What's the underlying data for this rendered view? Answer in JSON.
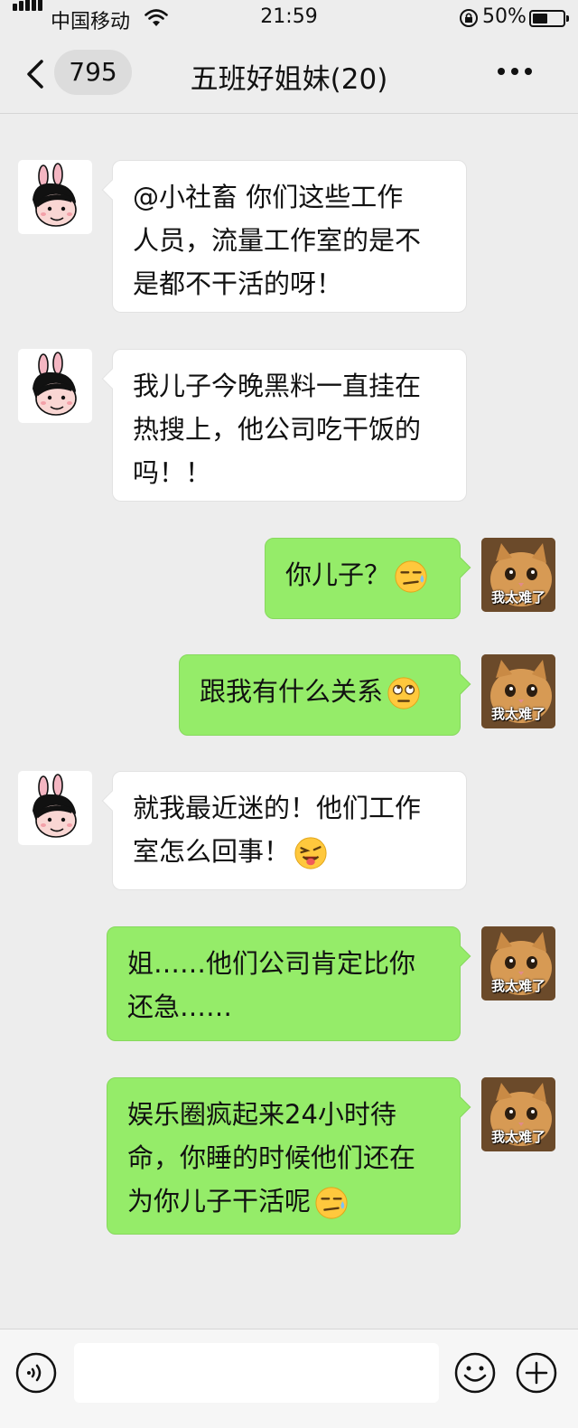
{
  "status_bar": {
    "carrier": "中国移动",
    "time": "21:59",
    "battery_percent": "50%",
    "battery_level": 0.5
  },
  "nav": {
    "unread_count": "795",
    "chat_title": "五班好姐妹(20)"
  },
  "messages": [
    {
      "side": "left",
      "text": "@小社畜 你们这些工作\n人员，流量工作室的是不\n是都不干活的呀！"
    },
    {
      "side": "left",
      "text": "我儿子今晚黑料一直挂在\n热搜上，他公司吃干饭的\n吗！！"
    },
    {
      "side": "right",
      "text": "你儿子？",
      "emoji": "smirk-sweat-emoji",
      "sticker_caption": "我太难了"
    },
    {
      "side": "right",
      "text": "跟我有什么关系",
      "emoji": "eye-roll-emoji",
      "sticker_caption": "我太难了"
    },
    {
      "side": "left",
      "text": "就我最近迷的！他们工作\n室怎么回事！",
      "emoji": "tongue-wink-emoji"
    },
    {
      "side": "right",
      "text": "姐……他们公司肯定比你\n还急……",
      "sticker_caption": "我太难了"
    },
    {
      "side": "right",
      "text": "娱乐圈疯起来24小时待\n命，你睡的时候他们还在\n为你儿子干活呢",
      "emoji": "smirk-sweat-emoji",
      "sticker_caption": "我太难了"
    }
  ],
  "icons": {
    "back": "chevron-left-icon",
    "more": "more-dots-icon",
    "voice": "voice-input-icon",
    "emoji_button": "smiley-icon",
    "plus": "plus-circle-icon"
  },
  "colors": {
    "background": "#ededed",
    "outgoing_bubble": "#95ec69",
    "incoming_bubble": "#ffffff"
  }
}
